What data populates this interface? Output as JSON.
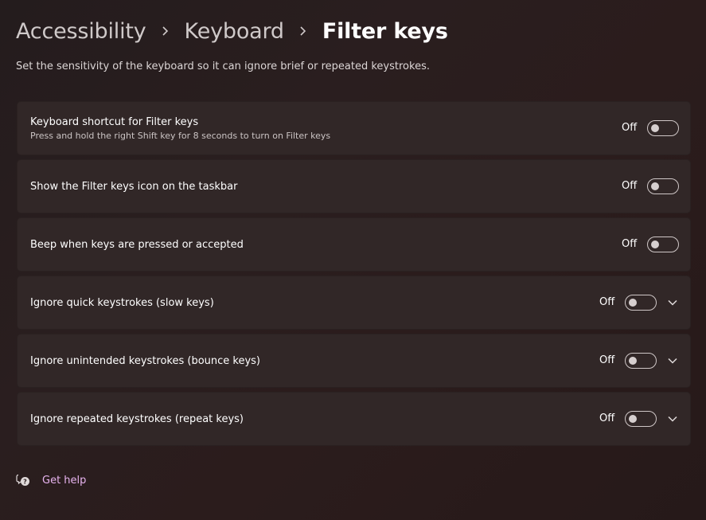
{
  "breadcrumb": {
    "items": [
      "Accessibility",
      "Keyboard",
      "Filter keys"
    ]
  },
  "description": "Set the sensitivity of the keyboard so it can ignore brief or repeated keystrokes.",
  "settings": [
    {
      "title": "Keyboard shortcut for Filter keys",
      "subtitle": "Press and hold the right Shift key for 8 seconds to turn on Filter keys",
      "state": "Off",
      "expandable": false
    },
    {
      "title": "Show the Filter keys icon on the taskbar",
      "state": "Off",
      "expandable": false
    },
    {
      "title": "Beep when keys are pressed or accepted",
      "state": "Off",
      "expandable": false
    },
    {
      "title": "Ignore quick keystrokes (slow keys)",
      "state": "Off",
      "expandable": true
    },
    {
      "title": "Ignore unintended keystrokes (bounce keys)",
      "state": "Off",
      "expandable": true
    },
    {
      "title": "Ignore repeated keystrokes (repeat keys)",
      "state": "Off",
      "expandable": true
    }
  ],
  "help": {
    "label": "Get help",
    "icon": "help-chat-icon"
  },
  "colors": {
    "accent_link": "#e8b4f0",
    "card_background": "#312727",
    "page_background": "#2a1e1f"
  }
}
